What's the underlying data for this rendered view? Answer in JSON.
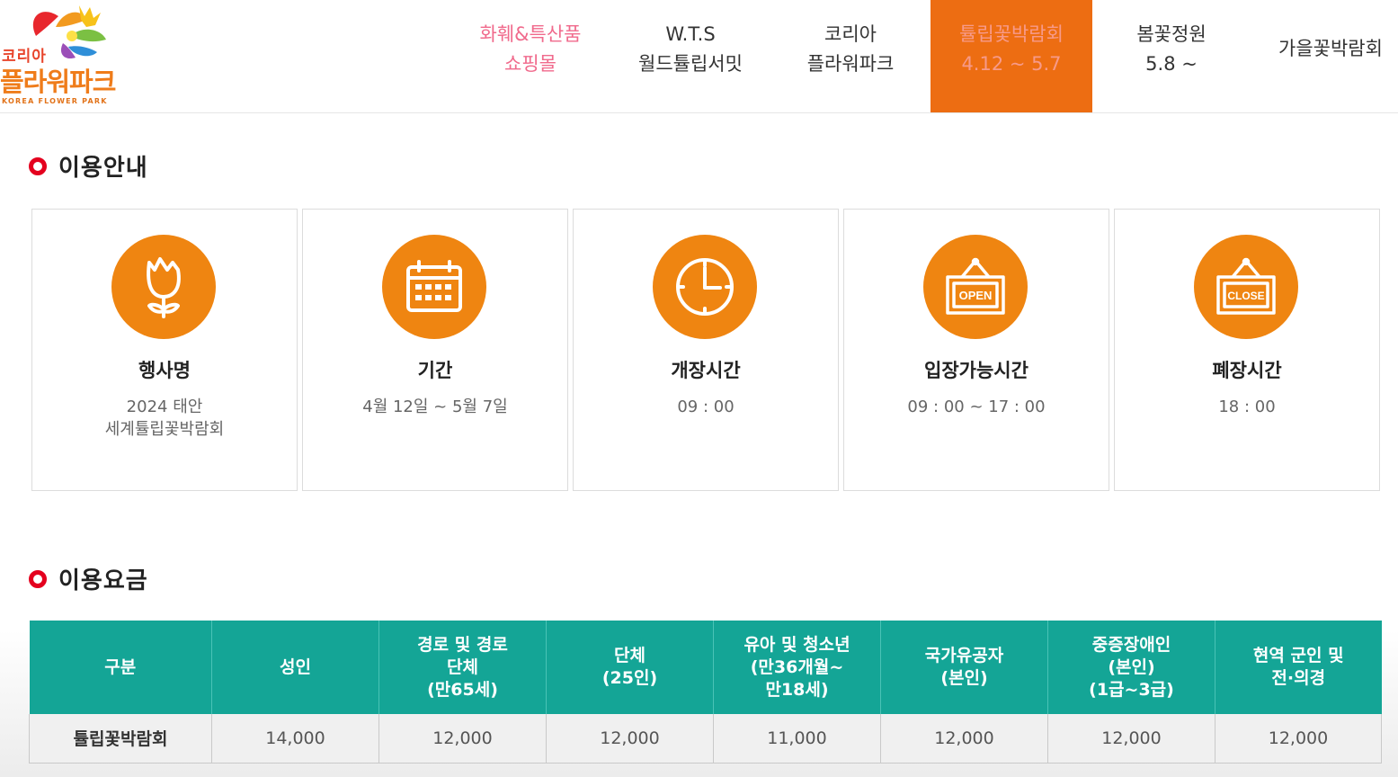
{
  "logo": {
    "line1": "코리아",
    "line2": "플라워파크",
    "line3": "KOREA FLOWER PARK"
  },
  "nav": [
    {
      "line1": "화훼&특산품",
      "line2": "쇼핑몰"
    },
    {
      "line1": "W.T.S",
      "line2": "월드튤립서밋"
    },
    {
      "line1": "코리아",
      "line2": "플라워파크"
    },
    {
      "line1": "튤립꽃박람회",
      "line2": "4.12 ~ 5.7"
    },
    {
      "line1": "봄꽃정원",
      "line2": "5.8 ~"
    },
    {
      "line1": "가을꽃박람회",
      "line2": ""
    }
  ],
  "usage_section": {
    "title": "이용안내",
    "cards": [
      {
        "icon": "tulip-icon",
        "label": "행사명",
        "value_line1": "2024 태안",
        "value_line2": "세계튤립꽃박람회"
      },
      {
        "icon": "calendar-icon",
        "label": "기간",
        "value_line1": "4월 12일 ~ 5월 7일",
        "value_line2": ""
      },
      {
        "icon": "clock-icon",
        "label": "개장시간",
        "value_line1": "09 : 00",
        "value_line2": ""
      },
      {
        "icon": "open-sign-icon",
        "label": "입장가능시간",
        "value_line1": "09 : 00 ~ 17 : 00",
        "value_line2": ""
      },
      {
        "icon": "close-sign-icon",
        "label": "폐장시간",
        "value_line1": "18 : 00",
        "value_line2": ""
      }
    ],
    "open_sign_text": "OPEN",
    "close_sign_text": "CLOSE"
  },
  "fee_section": {
    "title": "이용요금",
    "headers": [
      [
        "구분"
      ],
      [
        "성인"
      ],
      [
        "경로 및 경로",
        "단체",
        "(만65세)"
      ],
      [
        "단체",
        "(25인)"
      ],
      [
        "유아 및 청소년",
        "(만36개월~",
        "만18세)"
      ],
      [
        "국가유공자",
        "(본인)"
      ],
      [
        "중증장애인",
        "(본인)",
        "(1급~3급)"
      ],
      [
        "현역 군인 및",
        "전·의경"
      ]
    ],
    "rows": [
      [
        "튤립꽃박람회",
        "14,000",
        "12,000",
        "12,000",
        "11,000",
        "12,000",
        "12,000",
        "12,000"
      ]
    ]
  },
  "colors": {
    "accent_orange": "#ef8511",
    "active_nav": "#ed6d12",
    "table_header": "#14a596",
    "title_ring": "#e4001e"
  }
}
